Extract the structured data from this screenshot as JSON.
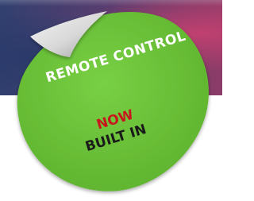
{
  "sticker": {
    "line1": "REMOTE CONTROL",
    "line2": "NOW",
    "line3": "BUILT IN"
  },
  "colors": {
    "sticker_green": "#6cc63a",
    "line1_text": "#ffffff",
    "line2_text": "#c8161d",
    "line3_text": "#1a1a1a"
  }
}
